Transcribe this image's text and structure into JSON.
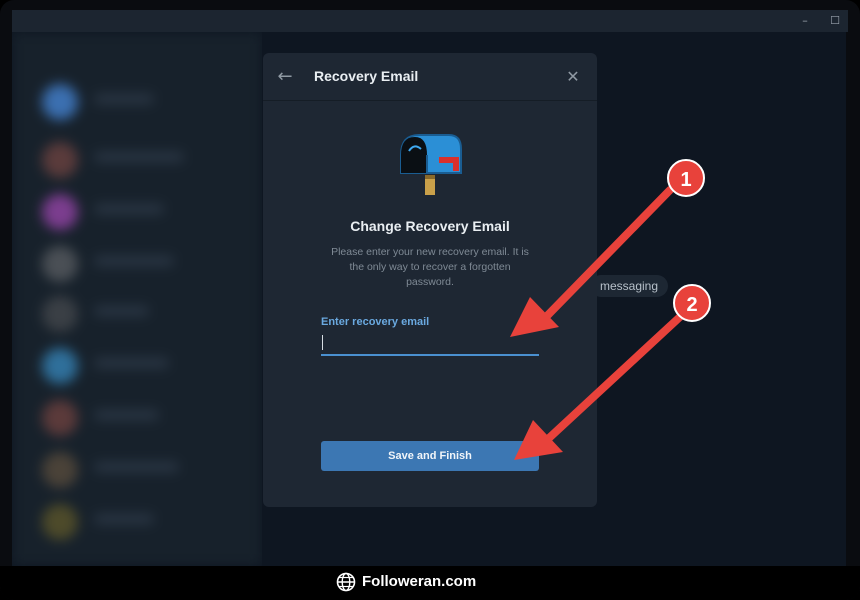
{
  "window": {
    "minimize_glyph": "–",
    "maximize_glyph": "☐"
  },
  "background": {
    "pill_text": "messaging"
  },
  "dialog": {
    "title": "Recovery Email",
    "back_icon": "arrow-left-icon",
    "close_icon": "close-icon",
    "illustration": "mailbox-icon",
    "heading": "Change Recovery Email",
    "description_lines": [
      "Please enter your new recovery email. It is",
      "the only way to recover a forgotten",
      "password."
    ],
    "field_label": "Enter recovery email",
    "field_value": "",
    "field_placeholder": "",
    "save_label": "Save and Finish"
  },
  "annotations": {
    "marker_1": "1",
    "marker_2": "2",
    "color": "#e8423b"
  },
  "footer": {
    "brand": "Followeran.com"
  },
  "colors": {
    "accent": "#3c77b3",
    "input_underline": "#4a90d0",
    "dialog_bg": "#1e2733",
    "app_bg": "#0e1621"
  }
}
